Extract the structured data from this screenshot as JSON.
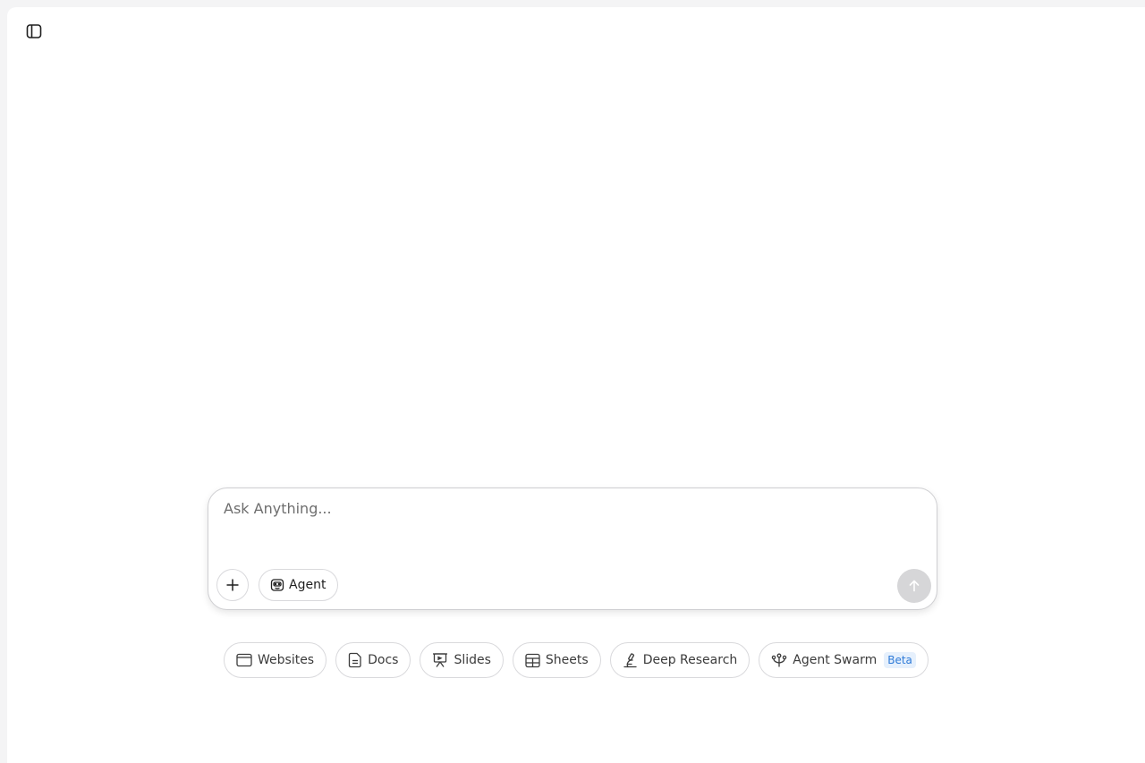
{
  "composer": {
    "placeholder": "Ask Anything...",
    "agent_label": "Agent"
  },
  "chips": [
    {
      "label": "Websites",
      "icon": "browser-window-icon"
    },
    {
      "label": "Docs",
      "icon": "document-icon"
    },
    {
      "label": "Slides",
      "icon": "presentation-icon"
    },
    {
      "label": "Sheets",
      "icon": "table-icon"
    },
    {
      "label": "Deep Research",
      "icon": "microscope-icon"
    },
    {
      "label": "Agent Swarm",
      "icon": "swarm-icon",
      "badge": "Beta"
    }
  ],
  "colors": {
    "badge_text": "#2f7bd8",
    "badge_bg": "#e6f0fc",
    "send_disabled": "#d6d6d8"
  }
}
